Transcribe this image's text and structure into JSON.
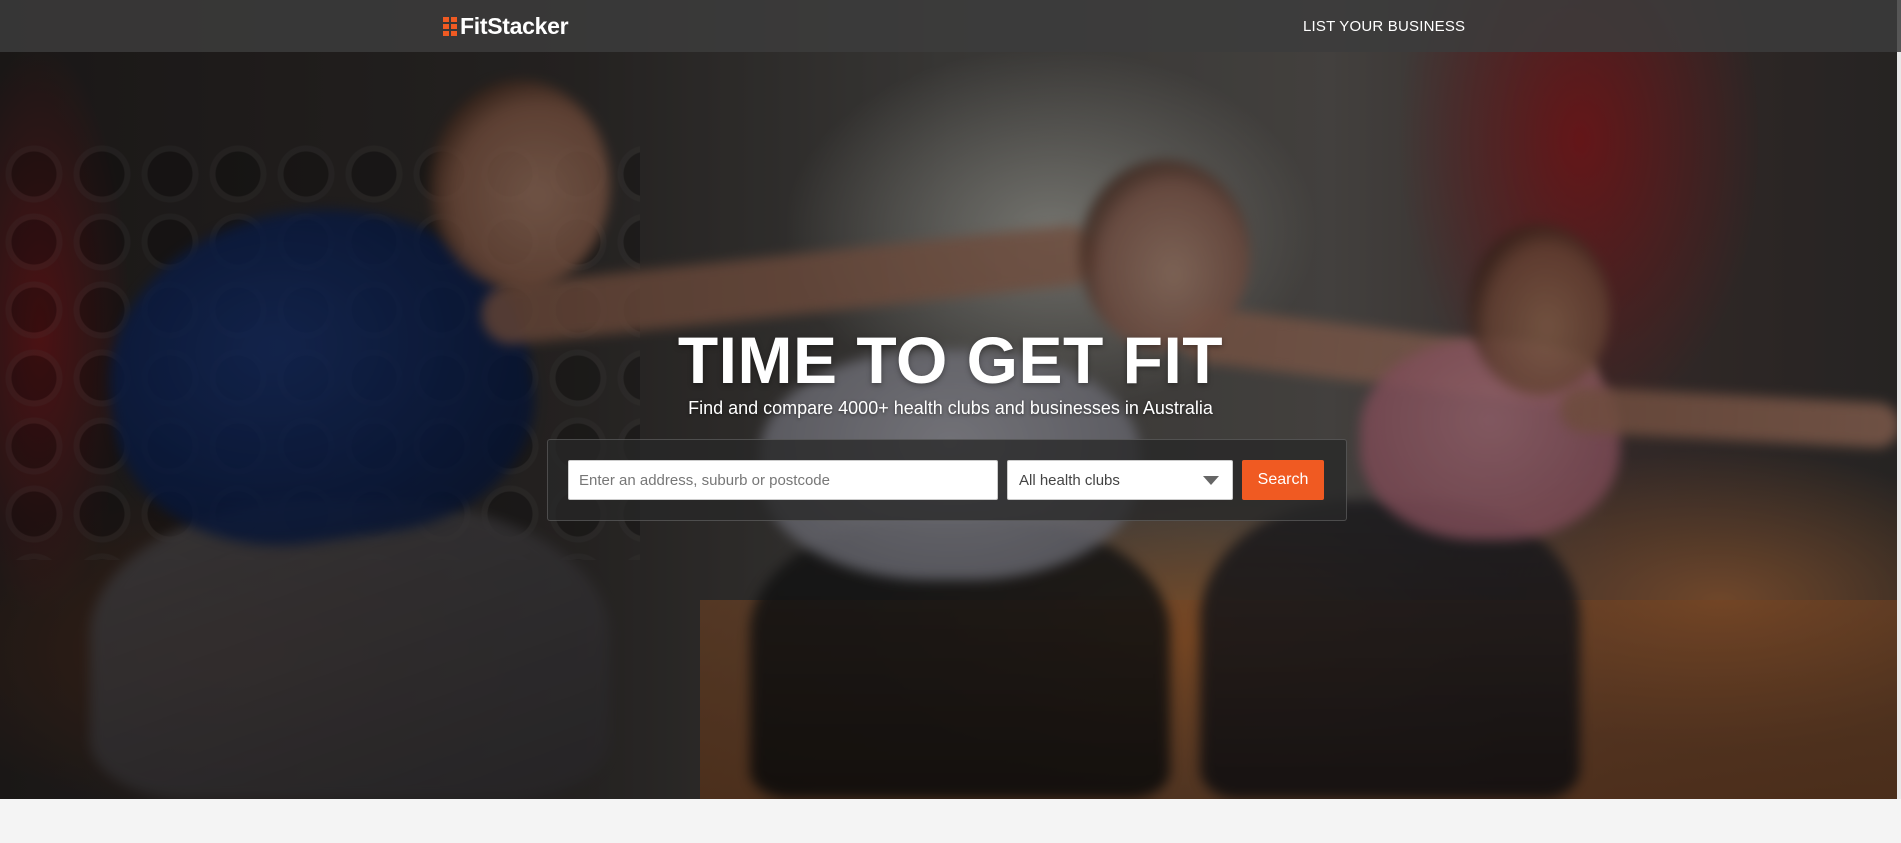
{
  "brand": {
    "name": "FitStacker",
    "logo_icon": "grid-logo-icon",
    "accent_color": "#f05a22"
  },
  "nav": {
    "list_business_label": "LIST YOUR BUSINESS"
  },
  "hero": {
    "headline": "TIME TO GET FIT",
    "subheadline": "Find and compare 4000+ health clubs and businesses in Australia"
  },
  "search": {
    "location_placeholder": "Enter an address, suburb or postcode",
    "location_value": "",
    "category_selected": "All health clubs",
    "button_label": "Search"
  }
}
